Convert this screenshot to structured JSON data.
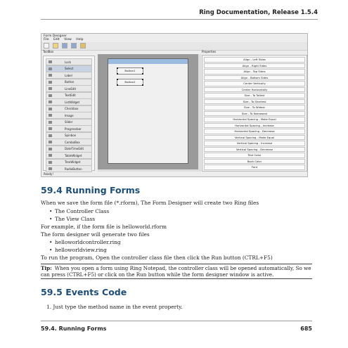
{
  "header": {
    "title": "Ring Documentation, Release 1.5.4"
  },
  "screenshot": {
    "window_title": "Form Designer",
    "menu": [
      "File",
      "Edit",
      "View",
      "Help"
    ],
    "toolbox_title": "ToolBox",
    "toolbox_items": [
      "Lock",
      "Select",
      "Label",
      "Button",
      "LineEdit",
      "TextEdit",
      "ListWidget",
      "Checkbox",
      "Image",
      "Slider",
      "Progressbar",
      "Spinbox",
      "ComboBox",
      "DateTimeEdit",
      "TableWidget",
      "TreeWidget",
      "RadioButton"
    ],
    "selected_tool": "Select",
    "properties_title": "Properties",
    "property_buttons": [
      "Align - Left Sides",
      "Align - Right Sides",
      "Align - Top Sides",
      "Align - Bottom Sides",
      "Center Vertically",
      "Center Horizontally",
      "Size - To Tallest",
      "Size - To Shortest",
      "Size - To Widest",
      "Size - To Narrowest",
      "Horizontal Spacing - Make Equal",
      "Horizontal Spacing - Increase",
      "Horizontal Spacing - Decrease",
      "Vertical Spacing - Make Equal",
      "Vertical Spacing - Increase",
      "Vertical Spacing - Decrease",
      "Text Color",
      "Back Color",
      "Font"
    ],
    "form_buttons": [
      "Button1",
      "Button2"
    ],
    "status": "Ready!"
  },
  "section1": {
    "heading": "59.4  Running Forms",
    "intro": "When we save the form file (*.rform), The Form Designer will create two Ring files",
    "classes": [
      "The Controller Class",
      "The View Class"
    ],
    "example": "For example, if the form file is helloworld.rform",
    "generates": "The form designer will generate two files",
    "files": [
      "helloworldcontroller.ring",
      "helloworldview.ring"
    ],
    "run": "To run the program, Open the controller class file then click the Run button (CTRL+F5)"
  },
  "tip": {
    "label": "Tip:",
    "text": "When you open a form using Ring Notepad, the controller class will be opened automatically, So we can press (CTRL+F5) or click on the Run button while the form designer window is active."
  },
  "section2": {
    "heading": "59.5  Events Code",
    "step1": "1. Just type the method name in the event property."
  },
  "footer": {
    "section": "59.4. Running Forms",
    "page": "685"
  }
}
